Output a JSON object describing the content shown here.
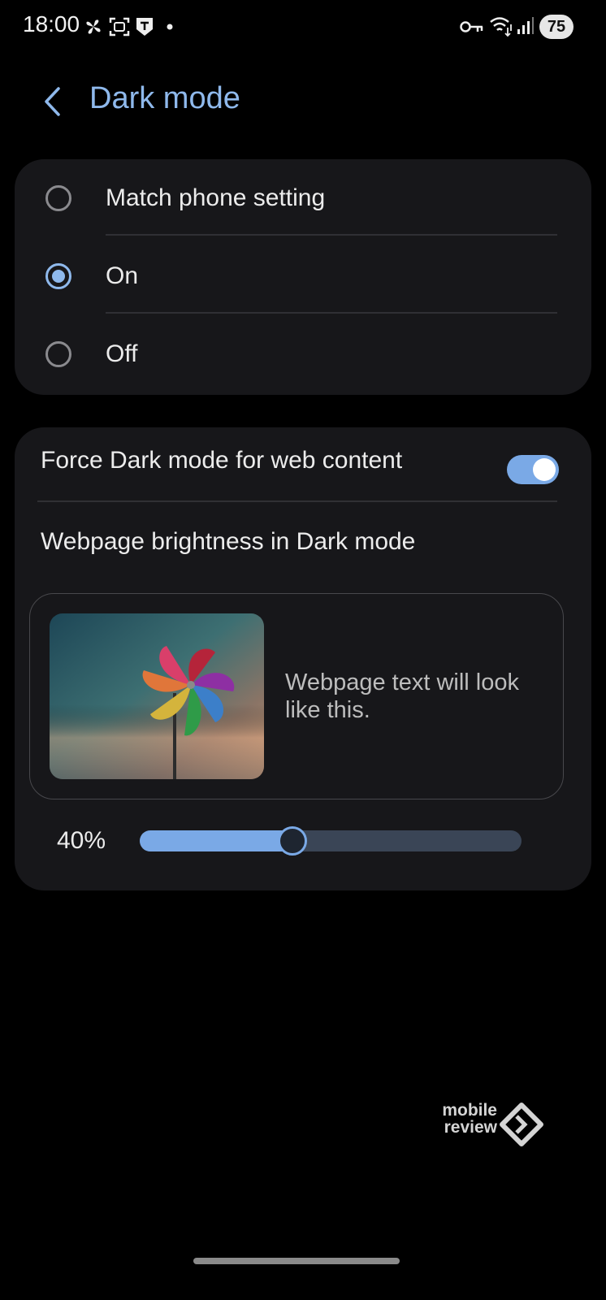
{
  "status_bar": {
    "time": "18:00",
    "battery": "75",
    "left_icons": [
      "pinwheel-icon",
      "screen-capture-icon",
      "shield-t-icon",
      "dot-icon"
    ],
    "right_icons": [
      "key-icon",
      "wifi-icon",
      "signal-icon",
      "battery-icon"
    ]
  },
  "header": {
    "title": "Dark mode",
    "back_icon": "chevron-left-icon"
  },
  "mode_options": {
    "items": [
      {
        "label": "Match phone setting",
        "checked": false
      },
      {
        "label": "On",
        "checked": true
      },
      {
        "label": "Off",
        "checked": false
      }
    ]
  },
  "web_content": {
    "force_label": "Force Dark mode for web content",
    "force_enabled": true,
    "brightness_label": "Webpage brightness in Dark mode",
    "preview_text": "Webpage text will look like this.",
    "brightness_value": 0.4,
    "brightness_text": "40%"
  },
  "watermark": {
    "line1": "mobile",
    "line2": "review"
  },
  "colors": {
    "accent": "#8fb9ec",
    "toggle_on": "#7aa9e6",
    "card_bg": "#17171a",
    "page_bg": "#000000"
  }
}
